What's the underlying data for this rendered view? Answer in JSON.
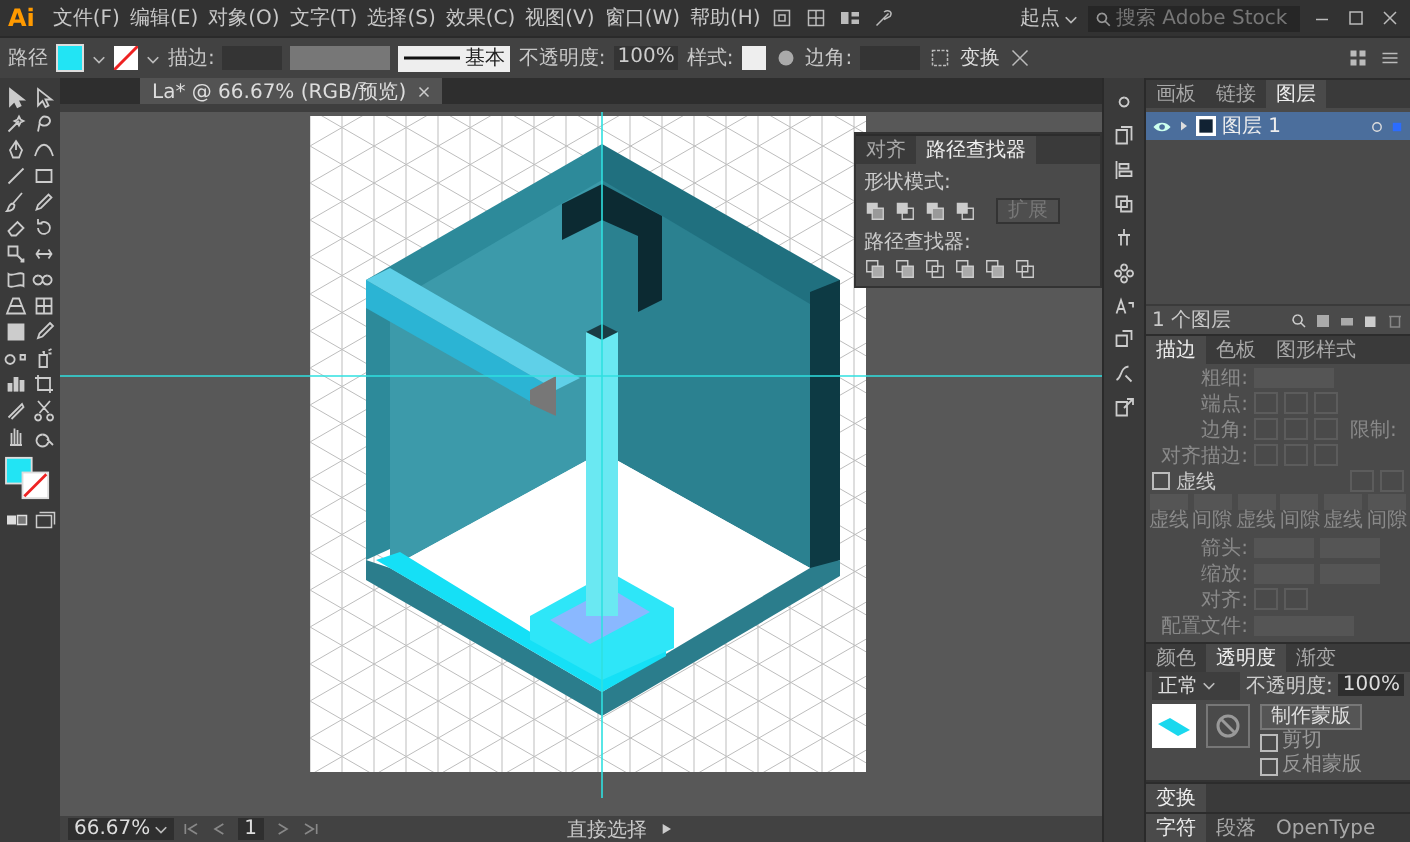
{
  "app_logo": "Ai",
  "menu": [
    "文件(F)",
    "编辑(E)",
    "对象(O)",
    "文字(T)",
    "选择(S)",
    "效果(C)",
    "视图(V)",
    "窗口(W)",
    "帮助(H)"
  ],
  "workspace": "起点",
  "search": {
    "placeholder": "搜索 Adobe Stock"
  },
  "control_bar": {
    "object_type": "路径",
    "stroke_label": "描边:",
    "brush": "基本",
    "opacity_label": "不透明度:",
    "opacity": "100%",
    "style_label": "样式:",
    "corner_label": "边角:",
    "transform": "变换"
  },
  "document_tab": {
    "title": "La* @ 66.67% (RGB/预览)"
  },
  "pathfinder_panel": {
    "tabs": [
      {
        "label": "对齐",
        "selected": false
      },
      {
        "label": "路径查找器",
        "selected": true
      }
    ],
    "shape_modes_label": "形状模式:",
    "expand": "扩展",
    "expand_disabled": true,
    "pathfinders_label": "路径查找器:"
  },
  "layers_panel": {
    "tabs": [
      {
        "label": "画板",
        "selected": false
      },
      {
        "label": "链接",
        "selected": false
      },
      {
        "label": "图层",
        "selected": true
      }
    ],
    "layers": [
      {
        "name": "图层 1",
        "visible": true,
        "expanded": false,
        "selected": true
      }
    ],
    "count": "1 个图层"
  },
  "stroke_panel": {
    "tabs": [
      {
        "label": "描边",
        "selected": true
      },
      {
        "label": "色板",
        "selected": false
      },
      {
        "label": "图形样式",
        "selected": false
      }
    ],
    "weight_label": "粗细:",
    "cap_label": "端点:",
    "corner_label": "边角:",
    "limit_label": "限制:",
    "align_label": "对齐描边:",
    "dashed": {
      "label": "虚线",
      "checked": false
    },
    "dash_labels": [
      "虚线",
      "间隙",
      "虚线",
      "间隙",
      "虚线",
      "间隙"
    ],
    "arrow_label": "箭头:",
    "scale_label": "缩放:",
    "arrow_align_label": "对齐:",
    "profile_label": "配置文件:"
  },
  "transparency_panel": {
    "tabs": [
      {
        "label": "颜色",
        "selected": false
      },
      {
        "label": "透明度",
        "selected": true
      },
      {
        "label": "渐变",
        "selected": false
      }
    ],
    "blend_mode": "正常",
    "opacity_label": "不透明度:",
    "opacity": "100%",
    "make_mask": "制作蒙版",
    "clip": {
      "label": "剪切",
      "checked": false
    },
    "invert": {
      "label": "反相蒙版",
      "checked": false
    }
  },
  "transform_panel": {
    "label": "变换"
  },
  "character_panel": {
    "tabs": [
      {
        "label": "字符",
        "selected": true
      },
      {
        "label": "段落",
        "selected": false
      },
      {
        "label": "OpenType",
        "selected": false
      }
    ]
  },
  "status_bar": {
    "zoom": "66.67%",
    "artboard": "1",
    "tool": "直接选择"
  }
}
